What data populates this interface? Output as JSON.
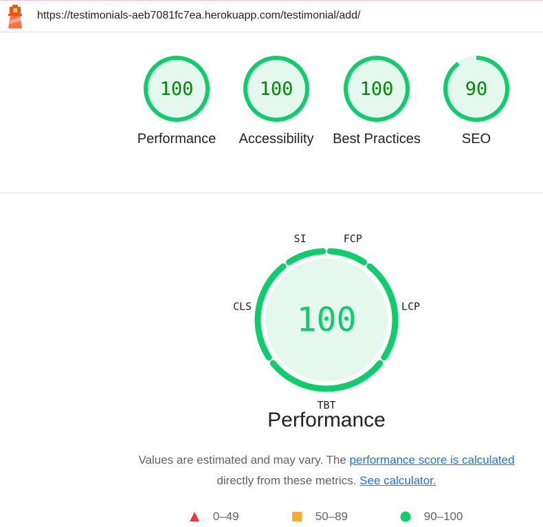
{
  "header": {
    "url": "https://testimonials-aeb7081fc7ea.herokuapp.com/testimonial/add/",
    "icon": "lighthouse-icon"
  },
  "categories": [
    {
      "score": "100",
      "value": 100,
      "label": "Performance"
    },
    {
      "score": "100",
      "value": 100,
      "label": "Accessibility"
    },
    {
      "score": "100",
      "value": 100,
      "label": "Best Practices"
    },
    {
      "score": "90",
      "value": 90,
      "label": "SEO"
    }
  ],
  "performance": {
    "score": "100",
    "title": "Performance",
    "metrics": [
      {
        "id": "FCP",
        "label": "FCP",
        "fill": 1
      },
      {
        "id": "LCP",
        "label": "LCP",
        "fill": 1
      },
      {
        "id": "TBT",
        "label": "TBT",
        "fill": 1
      },
      {
        "id": "CLS",
        "label": "CLS",
        "fill": 1
      },
      {
        "id": "SI",
        "label": "SI",
        "fill": 1
      }
    ],
    "note_text1": "Values are estimated and may vary. The ",
    "note_link1": "performance score is calculated",
    "note_text2": "directly from these metrics.",
    "note_link2": "See calculator."
  },
  "legend": [
    {
      "range": "0–49",
      "shape": "triangle",
      "color": "#ff3333"
    },
    {
      "range": "50–89",
      "shape": "square",
      "color": "#ffaa33"
    },
    {
      "range": "90–100",
      "shape": "circle",
      "color": "#0cce6b"
    }
  ],
  "colors": {
    "pass": "#0cce6b",
    "pass_text": "#008800",
    "pass_fill": "#e5f8ee"
  }
}
